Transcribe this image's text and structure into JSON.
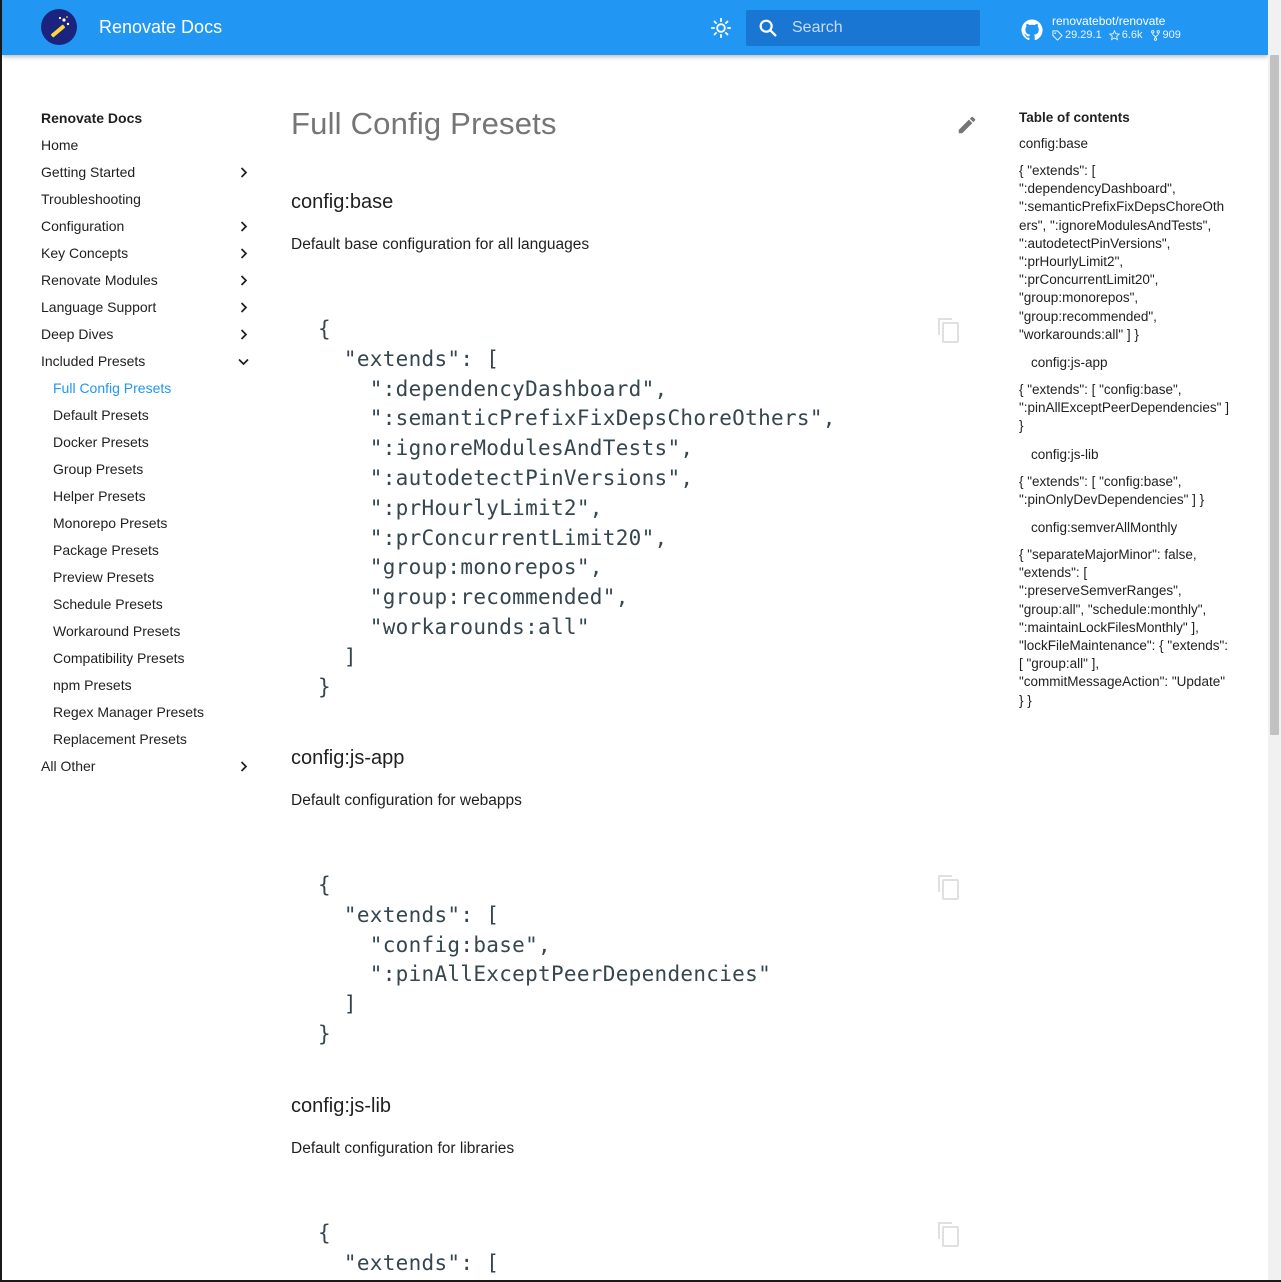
{
  "header": {
    "site_title": "Renovate Docs",
    "search_placeholder": "Search",
    "repo": {
      "name": "renovatebot/renovate",
      "version": "29.29.1",
      "stars": "6.6k",
      "forks": "909"
    },
    "colors": {
      "primary": "#2196f3",
      "search_bg": "#1976d2",
      "logo_bg": "#1a237e"
    }
  },
  "nav": {
    "title": "Renovate Docs",
    "items": [
      {
        "label": "Home",
        "icon": ""
      },
      {
        "label": "Getting Started",
        "icon": "chevron-right-icon"
      },
      {
        "label": "Troubleshooting",
        "icon": ""
      },
      {
        "label": "Configuration",
        "icon": "chevron-right-icon"
      },
      {
        "label": "Key Concepts",
        "icon": "chevron-right-icon"
      },
      {
        "label": "Renovate Modules",
        "icon": "chevron-right-icon"
      },
      {
        "label": "Language Support",
        "icon": "chevron-right-icon"
      },
      {
        "label": "Deep Dives",
        "icon": "chevron-right-icon"
      },
      {
        "label": "Included Presets",
        "icon": "chevron-down-icon"
      }
    ],
    "sub_items": [
      "Full Config Presets",
      "Default Presets",
      "Docker Presets",
      "Group Presets",
      "Helper Presets",
      "Monorepo Presets",
      "Package Presets",
      "Preview Presets",
      "Schedule Presets",
      "Workaround Presets",
      "Compatibility Presets",
      "npm Presets",
      "Regex Manager Presets",
      "Replacement Presets"
    ],
    "active_sub_item": "Full Config Presets",
    "last_item": {
      "label": "All Other",
      "icon": "chevron-right-icon"
    }
  },
  "main": {
    "title": "Full Config Presets",
    "sections": [
      {
        "heading": "config:base",
        "description": "Default base configuration for all languages",
        "code": "{\n  \"extends\": [\n    \":dependencyDashboard\",\n    \":semanticPrefixFixDepsChoreOthers\",\n    \":ignoreModulesAndTests\",\n    \":autodetectPinVersions\",\n    \":prHourlyLimit2\",\n    \":prConcurrentLimit20\",\n    \"group:monorepos\",\n    \"group:recommended\",\n    \"workarounds:all\"\n  ]\n}"
      },
      {
        "heading": "config:js-app",
        "description": "Default configuration for webapps",
        "code": "{\n  \"extends\": [\n    \"config:base\",\n    \":pinAllExceptPeerDependencies\"\n  ]\n}"
      },
      {
        "heading": "config:js-lib",
        "description": "Default configuration for libraries",
        "code": "{\n  \"extends\": ["
      }
    ]
  },
  "toc": {
    "title": "Table of contents",
    "entries": [
      {
        "text": "config:base",
        "kind": "heading",
        "indent": false
      },
      {
        "text": "{ \"extends\": [ \":dependencyDashboard\", \":semanticPrefixFixDepsChoreOthers\", \":ignoreModulesAndTests\", \":autodetectPinVersions\", \":prHourlyLimit2\", \":prConcurrentLimit20\", \"group:monorepos\", \"group:recommended\", \"workarounds:all\" ] }",
        "kind": "body",
        "indent": false
      },
      {
        "text": "config:js-app",
        "kind": "heading",
        "indent": true
      },
      {
        "text": "{ \"extends\": [ \"config:base\", \":pinAllExceptPeerDependencies\" ] }",
        "kind": "body",
        "indent": false
      },
      {
        "text": "config:js-lib",
        "kind": "heading",
        "indent": true
      },
      {
        "text": "{ \"extends\": [ \"config:base\", \":pinOnlyDevDependencies\" ] }",
        "kind": "body",
        "indent": false
      },
      {
        "text": "config:semverAllMonthly",
        "kind": "heading",
        "indent": true
      },
      {
        "text": "{ \"separateMajorMinor\": false, \"extends\": [ \":preserveSemverRanges\", \"group:all\", \"schedule:monthly\", \":maintainLockFilesMonthly\" ], \"lockFileMaintenance\": { \"extends\": [ \"group:all\" ], \"commitMessageAction\": \"Update\" } }",
        "kind": "body",
        "indent": false
      }
    ]
  }
}
